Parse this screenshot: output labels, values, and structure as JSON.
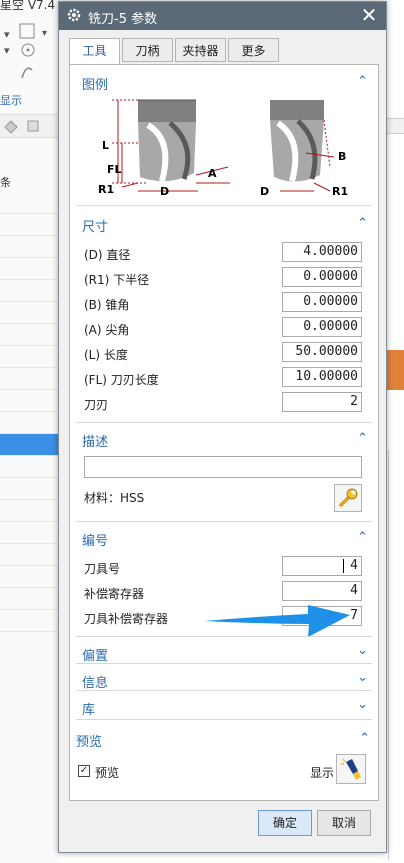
{
  "background": {
    "title_fragment": "星空 V7.4",
    "show_label": "显示",
    "list_header": "条"
  },
  "dialog": {
    "title": "铣刀-5 参数",
    "tabs": [
      {
        "label": "工具"
      },
      {
        "label": "刀柄"
      },
      {
        "label": "夹持器"
      },
      {
        "label": "更多"
      }
    ],
    "legend": {
      "title": "图例",
      "diagram_labels": {
        "L": "L",
        "FL": "FL",
        "R1": "R1",
        "D": "D",
        "A": "A",
        "B": "B"
      }
    },
    "dimensions": {
      "title": "尺寸",
      "fields": [
        {
          "label": "(D) 直径",
          "value": "4.00000"
        },
        {
          "label": "(R1) 下半径",
          "value": "0.00000"
        },
        {
          "label": "(B) 锥角",
          "value": "0.00000"
        },
        {
          "label": "(A) 尖角",
          "value": "0.00000"
        },
        {
          "label": "(L) 长度",
          "value": "50.00000"
        },
        {
          "label": "(FL) 刀刃长度",
          "value": "10.00000"
        },
        {
          "label": "刀刃",
          "value": "2"
        }
      ]
    },
    "description": {
      "title": "描述",
      "input_value": "",
      "material_label": "材料：HSS"
    },
    "numbering": {
      "title": "编号",
      "fields": [
        {
          "label": "刀具号",
          "value": "4"
        },
        {
          "label": "补偿寄存器",
          "value": "4"
        },
        {
          "label": "刀具补偿寄存器",
          "value": "7"
        }
      ]
    },
    "collapsed_sections": [
      {
        "title": "偏置"
      },
      {
        "title": "信息"
      },
      {
        "title": "库"
      }
    ],
    "preview": {
      "title": "预览",
      "checkbox_label": "预览",
      "checked": true,
      "show_label": "显示"
    },
    "buttons": {
      "ok": "确定",
      "cancel": "取消"
    }
  },
  "colors": {
    "titlebar": "#5b6876",
    "section_title": "#2b6cb0",
    "annotation_arrow": "#1e90e8",
    "diagram_red": "#b01818"
  }
}
